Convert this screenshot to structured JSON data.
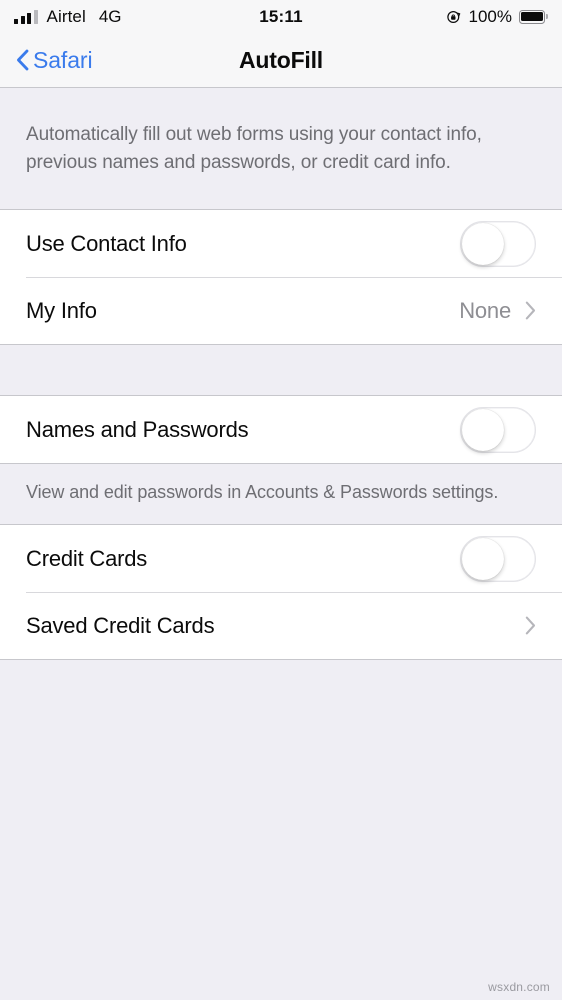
{
  "status_bar": {
    "carrier": "Airtel",
    "network": "4G",
    "time": "15:11",
    "battery_percent": "100%",
    "signal_bars_filled": 3,
    "signal_bars_total": 4,
    "rotation_lock_icon": "rotation-lock-icon",
    "battery_icon": "battery-full-icon"
  },
  "nav": {
    "back_label": "Safari",
    "back_icon": "chevron-left-icon",
    "title": "AutoFill"
  },
  "description": "Automatically fill out web forms using your contact info, previous names and passwords, or credit card info.",
  "groups": [
    {
      "rows": [
        {
          "label": "Use Contact Info",
          "control": "toggle",
          "state": "off"
        },
        {
          "label": "My Info",
          "control": "disclosure",
          "value": "None",
          "icon": "chevron-right-icon"
        }
      ],
      "footer": ""
    },
    {
      "rows": [
        {
          "label": "Names and Passwords",
          "control": "toggle",
          "state": "off"
        }
      ],
      "footer": "View and edit passwords in Accounts & Passwords settings."
    },
    {
      "rows": [
        {
          "label": "Credit Cards",
          "control": "toggle",
          "state": "off"
        },
        {
          "label": "Saved Credit Cards",
          "control": "disclosure",
          "value": "",
          "icon": "chevron-right-icon"
        }
      ],
      "footer": ""
    }
  ],
  "watermark": "wsxdn.com",
  "colors": {
    "accent_blue": "#3a7bec",
    "page_background": "#efeef4",
    "row_background": "#ffffff",
    "separator": "#c7c7cc",
    "secondary_text": "#8e8e93",
    "note_text": "#6e6e73"
  }
}
